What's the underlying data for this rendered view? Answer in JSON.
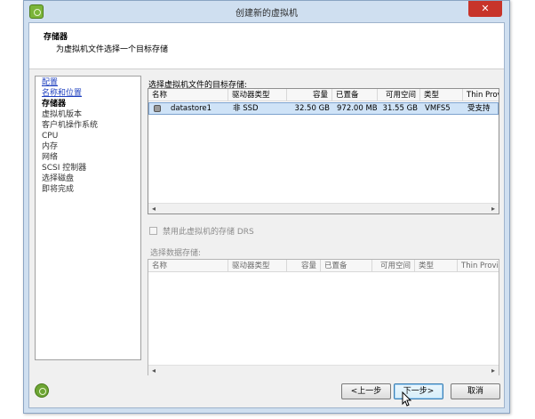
{
  "window": {
    "title": "创建新的虚拟机",
    "close_label": "✕"
  },
  "header": {
    "title": "存储器",
    "subtitle": "为虚拟机文件选择一个目标存储"
  },
  "nav": {
    "items": [
      {
        "label": "配置",
        "state": "link"
      },
      {
        "label": "名称和位置",
        "state": "link"
      },
      {
        "label": "存储器",
        "state": "current"
      },
      {
        "label": "虚拟机版本",
        "state": "normal"
      },
      {
        "label": "客户机操作系统",
        "state": "normal"
      },
      {
        "label": "CPU",
        "state": "normal"
      },
      {
        "label": "内存",
        "state": "normal"
      },
      {
        "label": "网络",
        "state": "normal"
      },
      {
        "label": "SCSI 控制器",
        "state": "normal"
      },
      {
        "label": "选择磁盘",
        "state": "normal"
      },
      {
        "label": "即将完成",
        "state": "normal"
      }
    ]
  },
  "storage_table": {
    "label": "选择虚拟机文件的目标存储:",
    "columns": [
      "名称",
      "驱动器类型",
      "容量",
      "已置备",
      "可用空间",
      "类型",
      "Thin Provi"
    ],
    "rows": [
      {
        "name": "datastore1",
        "drive_type": "非 SSD",
        "capacity": "32.50 GB",
        "provisioned": "972.00 MB",
        "free": "31.55 GB",
        "type": "VMFS5",
        "thin": "受支持"
      }
    ]
  },
  "drs": {
    "label": "禁用此虚拟机的存储 DRS",
    "checked": false
  },
  "datastore_table": {
    "label": "选择数据存储:",
    "columns": [
      "名称",
      "驱动器类型",
      "容量",
      "已置备",
      "可用空间",
      "类型",
      "Thin Provi"
    ]
  },
  "footer": {
    "back_label": "<上一步",
    "next_label": "下一步>",
    "cancel_label": "取消"
  },
  "icons": {
    "app": "vmware-logo-icon",
    "help": "help-icon",
    "datastore": "datastore-icon",
    "scroll_left": "scroll-left-icon",
    "scroll_right": "scroll-right-icon",
    "cursor": "mouse-pointer-icon"
  },
  "colors": {
    "window_frame": "#cfdff0",
    "close_button": "#c7342a",
    "selected_row": "#cfe3f7",
    "link": "#1d3fbf"
  }
}
